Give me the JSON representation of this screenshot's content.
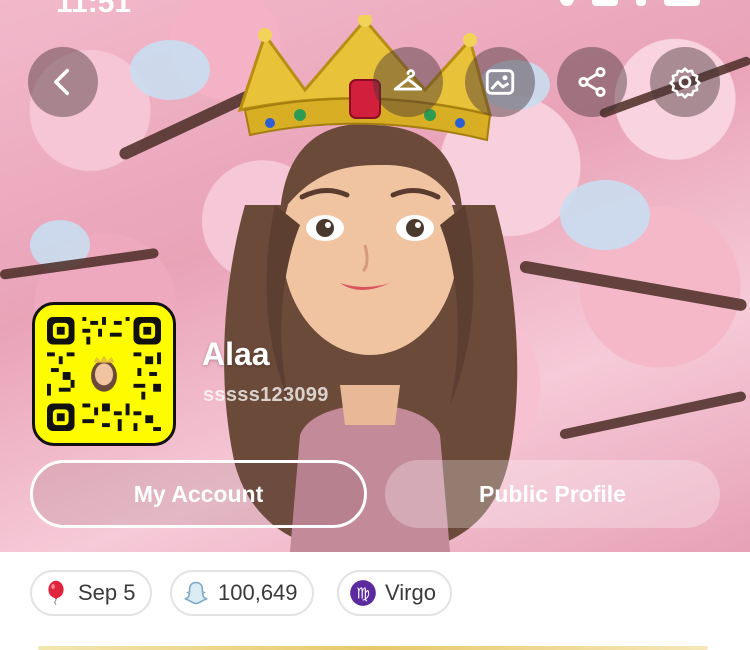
{
  "status_bar": {
    "time": "11:51"
  },
  "top_actions": [
    {
      "name": "back-button",
      "icon": "chevron-left-icon"
    },
    {
      "name": "wardrobe-button",
      "icon": "hanger-icon"
    },
    {
      "name": "profile-background-button",
      "icon": "image-icon"
    },
    {
      "name": "share-button",
      "icon": "share-icon"
    },
    {
      "name": "settings-button",
      "icon": "gear-icon"
    }
  ],
  "profile": {
    "display_name": "Alaa",
    "username": "sssss123099"
  },
  "buttons": {
    "my_account": "My Account",
    "public_profile": "Public Profile"
  },
  "chips": {
    "birthday": "Sep 5",
    "score": "100,649",
    "zodiac": "Virgo"
  },
  "colors": {
    "snapcode_yellow": "#fffc00",
    "zodiac_purple": "#5b2a9e",
    "birthday_red": "#e0243b"
  }
}
